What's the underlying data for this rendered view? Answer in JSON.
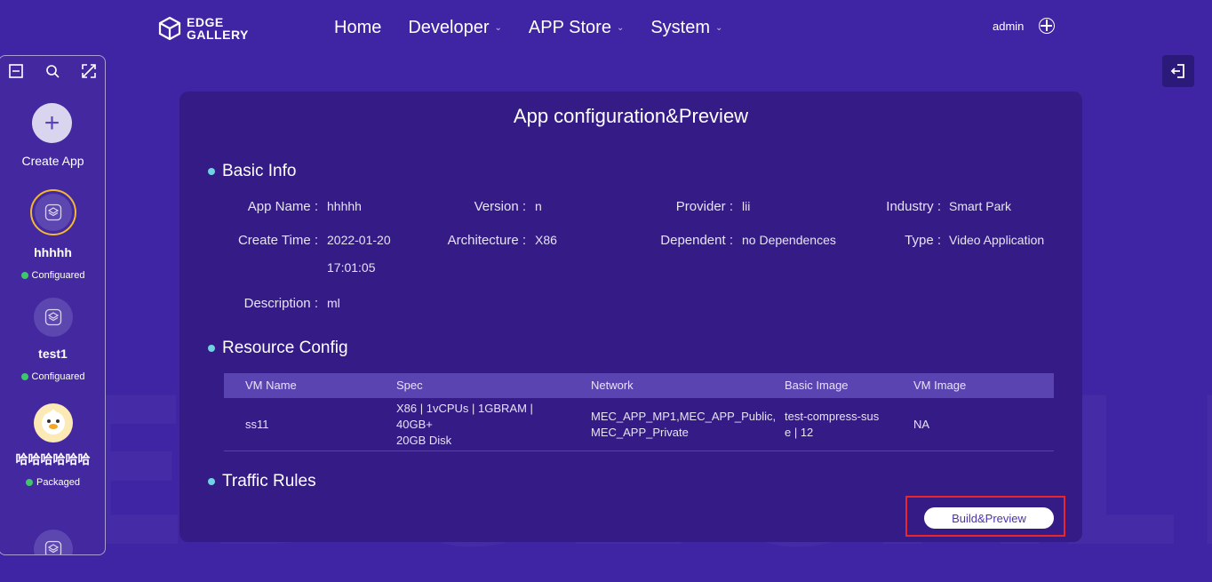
{
  "header": {
    "logo_line1": "EDGE",
    "logo_line2": "GALLERY",
    "nav": [
      {
        "label": "Home",
        "has_dropdown": false
      },
      {
        "label": "Developer",
        "has_dropdown": true
      },
      {
        "label": "APP Store",
        "has_dropdown": true
      },
      {
        "label": "System",
        "has_dropdown": true
      }
    ],
    "user": "admin"
  },
  "sidebar": {
    "create_label": "Create App",
    "apps": [
      {
        "name": "hhhhh",
        "status": "Configuared",
        "selected": true
      },
      {
        "name": "test1",
        "status": "Configuared",
        "selected": false
      },
      {
        "name": "哈哈哈哈哈哈",
        "status": "Packaged",
        "selected": false
      }
    ]
  },
  "watermark": "EDGEGALLERY",
  "panel": {
    "title": "App configuration&Preview",
    "basic_info": {
      "title": "Basic Info",
      "fields": {
        "app_name": {
          "label": "App Name :",
          "value": "hhhhh"
        },
        "version": {
          "label": "Version :",
          "value": "n"
        },
        "provider": {
          "label": "Provider :",
          "value": "lii"
        },
        "industry": {
          "label": "Industry :",
          "value": "Smart Park"
        },
        "create_time": {
          "label": "Create Time :",
          "value_line1": "2022-01-20",
          "value_line2": "17:01:05"
        },
        "architecture": {
          "label": "Architecture :",
          "value": "X86"
        },
        "dependent": {
          "label": "Dependent :",
          "value": "no Dependences"
        },
        "type": {
          "label": "Type :",
          "value": "Video Application"
        },
        "description": {
          "label": "Description :",
          "value": "ml"
        }
      }
    },
    "resource_config": {
      "title": "Resource Config",
      "columns": [
        "VM Name",
        "Spec",
        "Network",
        "Basic Image",
        "VM Image"
      ],
      "rows": [
        {
          "vm_name": "ss11",
          "spec_line1": "X86 | 1vCPUs | 1GBRAM | 40GB+",
          "spec_line2": "20GB Disk",
          "network_line1": "MEC_APP_MP1,MEC_APP_Public,",
          "network_line2": "MEC_APP_Private",
          "basic_image_line1": "test-compress-sus",
          "basic_image_line2": "e | 12",
          "vm_image": "NA"
        }
      ]
    },
    "traffic_rules": {
      "title": "Traffic Rules"
    },
    "build_button": "Build&Preview"
  },
  "colors": {
    "background": "#3f25a3",
    "panel": "#341b86",
    "accent_bullet": "#6fd3e3",
    "status_green": "#3fc66b",
    "highlight_red": "#e8262b",
    "selected_ring": "#f2b733"
  }
}
